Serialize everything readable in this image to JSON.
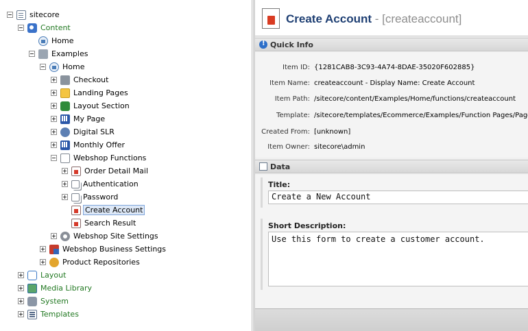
{
  "tree": {
    "nodes": [
      {
        "label": "sitecore",
        "icon": "page-icon",
        "green": false
      },
      {
        "label": "Content",
        "icon": "content-icon",
        "green": true
      },
      {
        "label": "Home",
        "icon": "home-icon",
        "green": false
      },
      {
        "label": "Examples",
        "icon": "examples-icon",
        "green": false
      },
      {
        "label": "Home",
        "icon": "home-icon",
        "green": false
      },
      {
        "label": "Checkout",
        "icon": "cart-icon",
        "green": false
      },
      {
        "label": "Landing Pages",
        "icon": "folder-icon",
        "green": false
      },
      {
        "label": "Layout Section",
        "icon": "layout-section-icon",
        "green": false
      },
      {
        "label": "My Page",
        "icon": "grid-icon",
        "green": false
      },
      {
        "label": "Digital SLR",
        "icon": "camera-icon",
        "green": false
      },
      {
        "label": "Monthly Offer",
        "icon": "grid-icon",
        "green": false
      },
      {
        "label": "Webshop Functions",
        "icon": "document-icon",
        "green": false
      },
      {
        "label": "Order Detail Mail",
        "icon": "red-page-icon",
        "green": false
      },
      {
        "label": "Authentication",
        "icon": "pages-icon",
        "green": false
      },
      {
        "label": "Password",
        "icon": "pages-icon",
        "green": false
      },
      {
        "label": "Create Account",
        "icon": "red-page-icon",
        "green": false
      },
      {
        "label": "Search Result",
        "icon": "red-page-icon",
        "green": false
      },
      {
        "label": "Webshop Site Settings",
        "icon": "gear-icon",
        "green": false
      },
      {
        "label": "Webshop Business Settings",
        "icon": "business-icon",
        "green": false
      },
      {
        "label": "Product Repositories",
        "icon": "box-icon",
        "green": false
      },
      {
        "label": "Layout",
        "icon": "layout-icon",
        "green": true
      },
      {
        "label": "Media Library",
        "icon": "media-icon",
        "green": true
      },
      {
        "label": "System",
        "icon": "system-icon",
        "green": true
      },
      {
        "label": "Templates",
        "icon": "templates-icon",
        "green": true
      }
    ]
  },
  "header": {
    "title": "Create Account",
    "subtitle": " - [createaccount]"
  },
  "quick_info": {
    "section_title": "Quick Info",
    "rows": [
      {
        "label": "Item ID:",
        "value": "{1281CAB8-3C93-4A74-8DAE-35020F602885}"
      },
      {
        "label": "Item Name:",
        "value": "createaccount - Display Name: Create Account"
      },
      {
        "label": "Item Path:",
        "value": "/sitecore/content/Examples/Home/functions/createaccount"
      },
      {
        "label": "Template:",
        "value": "/sitecore/templates/Ecommerce/Examples/Function Pages/Page"
      },
      {
        "label": "Created From:",
        "value": "[unknown]"
      },
      {
        "label": "Item Owner:",
        "value": "sitecore\\admin"
      }
    ]
  },
  "data_section": {
    "section_title": "Data",
    "title_label": "Title:",
    "title_value": "Create a New Account",
    "short_desc_label": "Short Description:",
    "short_desc_value": "Use this form to create a customer account."
  },
  "colors": {
    "header_title": "#1e3f73",
    "green_node": "#217821",
    "selection": "#dde8f7"
  }
}
